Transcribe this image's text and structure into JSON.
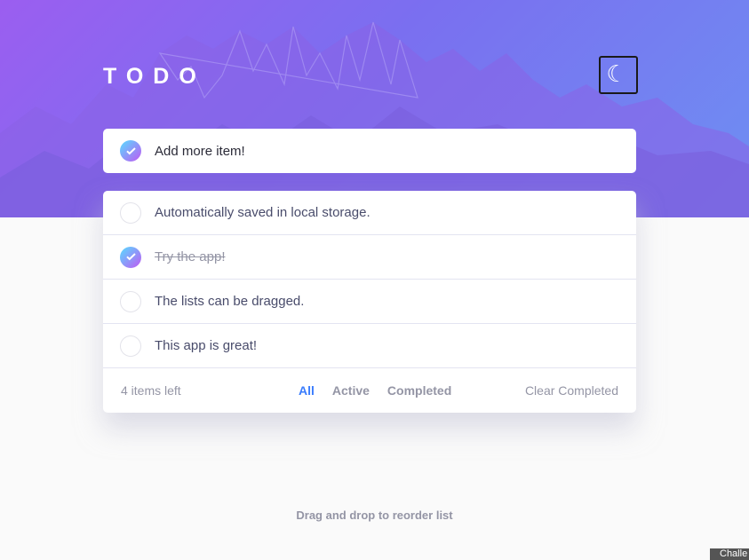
{
  "app": {
    "title": "TODO",
    "theme_toggle_icon": "moon-icon"
  },
  "colors": {
    "accent": "#3a7cfd",
    "check_gradient_start": "#57ddff",
    "check_gradient_end": "#c058f3",
    "hero_start": "#9b5ef0",
    "hero_end": "#6e8ff2"
  },
  "new_item": {
    "text": "Add more item!",
    "checked": true
  },
  "todos": [
    {
      "label": "Automatically saved in local storage.",
      "completed": false
    },
    {
      "label": "Try the app!",
      "completed": true
    },
    {
      "label": "The lists can be dragged.",
      "completed": false
    },
    {
      "label": "This app is great!",
      "completed": false
    }
  ],
  "footer": {
    "items_left": "4 items left",
    "filters": {
      "all": "All",
      "active": "Active",
      "completed": "Completed"
    },
    "active_filter": "all",
    "clear": "Clear Completed"
  },
  "hint": "Drag and drop to reorder list",
  "attribution": "Challe"
}
